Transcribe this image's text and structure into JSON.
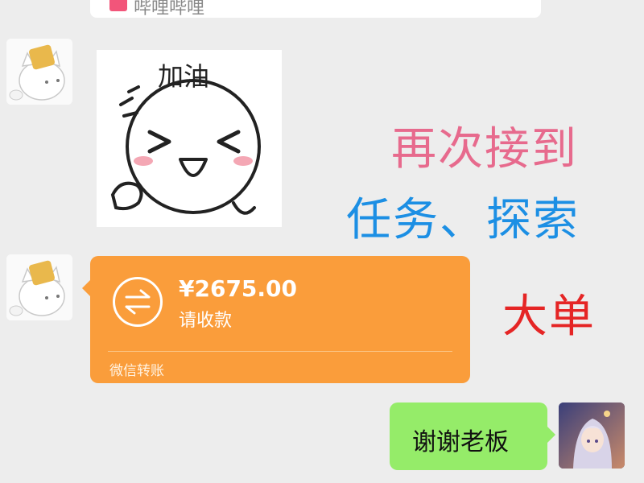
{
  "previous_message": {
    "text": "哔哩哔哩"
  },
  "sticker": {
    "text": "加油",
    "icon": "cheering-face-sticker"
  },
  "overlay": {
    "line1": "再次接到",
    "line2": "任务、探索",
    "line3": "大单",
    "colors": {
      "line1": "#e76a8d",
      "line2": "#1c8fe4",
      "line3": "#e52525"
    }
  },
  "transfer": {
    "amount": "¥2675.00",
    "status": "请收款",
    "footer": "微信转账",
    "icon": "transfer-arrows-icon",
    "color": "#fa9d3b"
  },
  "my_message": {
    "text": "谢谢老板",
    "color": "#95ec69"
  },
  "avatars": {
    "sender": "cat-avatar",
    "me": "anime-girl-avatar"
  }
}
